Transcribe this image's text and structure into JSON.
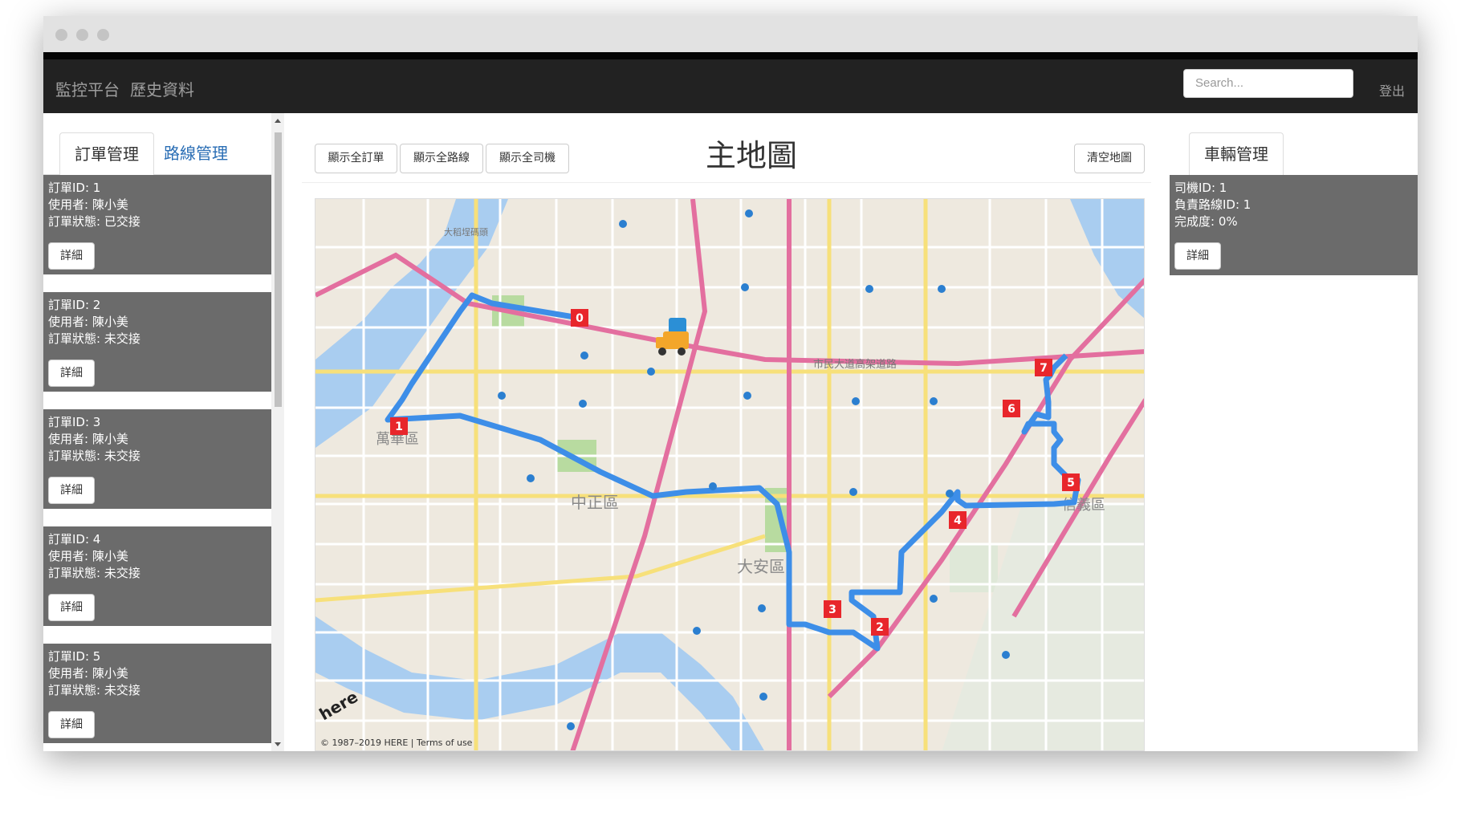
{
  "nav": {
    "brand": "監控平台",
    "history": "歷史資料",
    "search_placeholder": "Search...",
    "logout": "登出"
  },
  "left": {
    "tabs": [
      {
        "label": "訂單管理"
      },
      {
        "label": "路線管理"
      }
    ],
    "orders": [
      {
        "id": "訂單ID: 1",
        "user": "使用者: 陳小美",
        "status": "訂單狀態: 已交接",
        "detail": "詳細"
      },
      {
        "id": "訂單ID: 2",
        "user": "使用者: 陳小美",
        "status": "訂單狀態: 未交接",
        "detail": "詳細"
      },
      {
        "id": "訂單ID: 3",
        "user": "使用者: 陳小美",
        "status": "訂單狀態: 未交接",
        "detail": "詳細"
      },
      {
        "id": "訂單ID: 4",
        "user": "使用者: 陳小美",
        "status": "訂單狀態: 未交接",
        "detail": "詳細"
      },
      {
        "id": "訂單ID: 5",
        "user": "使用者: 陳小美",
        "status": "訂單狀態: 未交接",
        "detail": "詳細"
      }
    ]
  },
  "center": {
    "show_orders": "顯示全訂單",
    "show_routes": "顯示全路線",
    "show_drivers": "顯示全司機",
    "title": "主地圖",
    "clear_map": "清空地圖",
    "map": {
      "attribution": "© 1987–2019 HERE | Terms of use",
      "logo": "here",
      "districts": [
        "萬華區",
        "中正區",
        "大安區",
        "信義區"
      ],
      "streets": [
        "市民大道高架道路",
        "大稻埕碼頭"
      ],
      "markers": [
        "0",
        "1",
        "2",
        "3",
        "4",
        "5",
        "6",
        "7"
      ],
      "route_color": "#3d8ee8",
      "marker_color": "#e8262b"
    }
  },
  "right": {
    "tab": "車輛管理",
    "vehicle": {
      "driver": "司機ID: 1",
      "route": "負責路線ID: 1",
      "progress": "完成度: 0%",
      "detail": "詳細"
    }
  }
}
